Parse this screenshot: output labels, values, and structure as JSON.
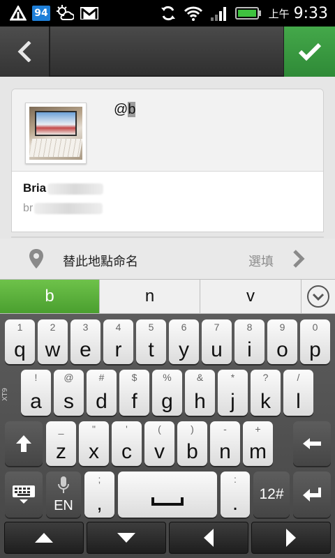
{
  "status_bar": {
    "battery_level": "94",
    "am_pm": "上午",
    "time": "9:33",
    "icons": [
      "upload-arrow-icon",
      "battery-percent-icon",
      "weather-icon",
      "gmail-icon",
      "sync-icon",
      "wifi-icon",
      "signal-icon",
      "battery-icon"
    ]
  },
  "action_bar": {
    "back_icon": "chevron-left-icon",
    "confirm_icon": "checkmark-icon",
    "accent_color": "#3a9a42"
  },
  "compose": {
    "mention_prefix": "@",
    "mention_cursor": "b",
    "user_name_visible": "Bria",
    "user_id_visible": "br"
  },
  "location": {
    "label": "替此地點命名",
    "optional": "選填"
  },
  "suggestions": [
    "b",
    "n",
    "v"
  ],
  "keyboard": {
    "row1": [
      {
        "hint": "1",
        "key": "q"
      },
      {
        "hint": "2",
        "key": "w"
      },
      {
        "hint": "3",
        "key": "e"
      },
      {
        "hint": "4",
        "key": "r"
      },
      {
        "hint": "5",
        "key": "t"
      },
      {
        "hint": "6",
        "key": "y"
      },
      {
        "hint": "7",
        "key": "u"
      },
      {
        "hint": "8",
        "key": "i"
      },
      {
        "hint": "9",
        "key": "o"
      },
      {
        "hint": "0",
        "key": "p"
      }
    ],
    "row2": [
      {
        "hint": "!",
        "key": "a"
      },
      {
        "hint": "@",
        "key": "s"
      },
      {
        "hint": "#",
        "key": "d"
      },
      {
        "hint": "$",
        "key": "f"
      },
      {
        "hint": "%",
        "key": "g"
      },
      {
        "hint": "&",
        "key": "h"
      },
      {
        "hint": "*",
        "key": "j"
      },
      {
        "hint": "?",
        "key": "k"
      },
      {
        "hint": "/",
        "key": "l"
      }
    ],
    "row3": [
      {
        "hint": "_",
        "key": "z"
      },
      {
        "hint": "\"",
        "key": "x"
      },
      {
        "hint": "'",
        "key": "c"
      },
      {
        "hint": "(",
        "key": "v"
      },
      {
        "hint": ")",
        "key": "b"
      },
      {
        "hint": "-",
        "key": "n"
      },
      {
        "hint": "+",
        "key": "m"
      }
    ],
    "lang": "EN",
    "comma_hint": ";",
    "comma": ",",
    "period_hint": ":",
    "period": ".",
    "symbols": "12#",
    "side_label": "XT9"
  }
}
